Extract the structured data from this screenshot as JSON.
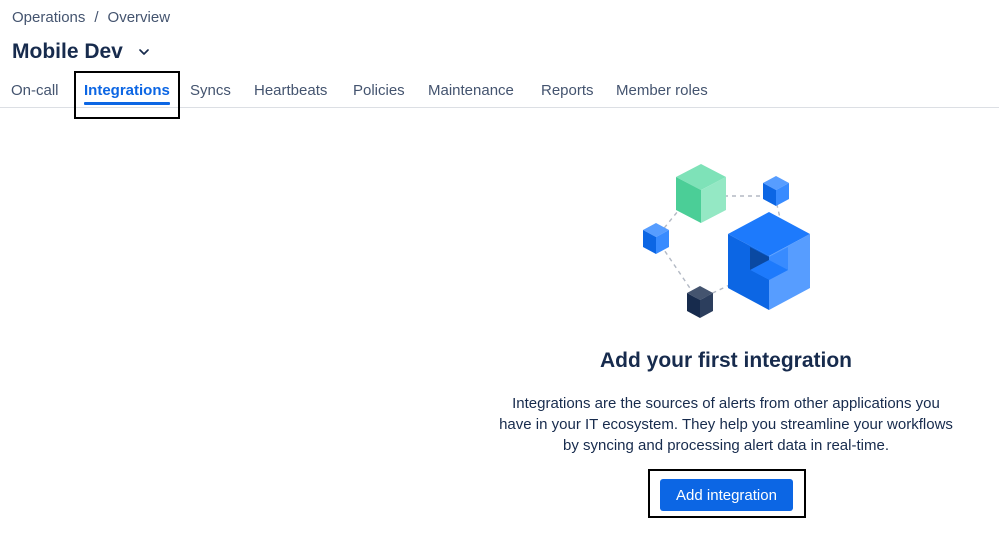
{
  "breadcrumb": {
    "items": [
      "Operations",
      "Overview"
    ],
    "separator": "/"
  },
  "header": {
    "title": "Mobile Dev",
    "chevron_icon": "chevron-down-icon"
  },
  "tabs": [
    {
      "label": "On-call",
      "active": false
    },
    {
      "label": "Integrations",
      "active": true
    },
    {
      "label": "Syncs",
      "active": false
    },
    {
      "label": "Heartbeats",
      "active": false
    },
    {
      "label": "Policies",
      "active": false
    },
    {
      "label": "Maintenance",
      "active": false
    },
    {
      "label": "Reports",
      "active": false
    },
    {
      "label": "Member roles",
      "active": false
    }
  ],
  "empty_state": {
    "illustration_icon": "integrations-cubes-illustration",
    "title": "Add your first integration",
    "description_lines": [
      "Integrations are the sources of alerts from other applications you",
      "have in your IT ecosystem. They help you streamline your workflows",
      "by syncing and processing alert data in real-time."
    ],
    "button_label": "Add integration"
  },
  "colors": {
    "accent": "#0c66e4",
    "text": "#172b4d",
    "subtle_text": "#44546f",
    "border": "#dcdfe4",
    "cube_green": "#4bce97",
    "cube_blue": "#1d7afc",
    "cube_dark": "#2c3e5d"
  }
}
